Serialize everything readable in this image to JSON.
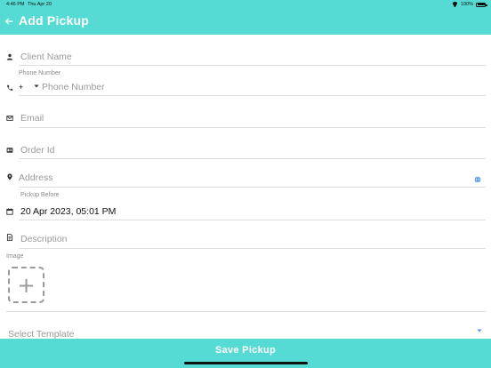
{
  "status_bar": {
    "time": "4:46 PM",
    "date": "Thu Apr 20",
    "battery": "100%"
  },
  "header": {
    "title": "Add Pickup",
    "back_icon": "back-arrow-icon"
  },
  "form": {
    "client_name": {
      "placeholder": "Client Name",
      "icon": "person-icon"
    },
    "phone": {
      "label": "Phone Number",
      "country_code": "+",
      "placeholder": "Phone Number",
      "icon": "phone-icon"
    },
    "email": {
      "placeholder": "Email",
      "icon": "envelope-icon"
    },
    "order_id": {
      "placeholder": "Order Id",
      "icon": "id-card-icon"
    },
    "address": {
      "placeholder": "Address",
      "icon": "location-pin-icon",
      "action_icon": "globe-icon"
    },
    "pickup_before": {
      "label": "Pickup Before",
      "value": "20 Apr 2023, 05:01 PM",
      "icon": "calendar-icon"
    },
    "description": {
      "placeholder": "Description",
      "icon": "document-icon"
    },
    "image": {
      "label": "Image",
      "add_icon": "+"
    },
    "template": {
      "placeholder": "Select Template",
      "icon": "dropdown-arrow-icon"
    }
  },
  "footer": {
    "save_label": "Save Pickup"
  },
  "colors": {
    "accent": "#55dbd3",
    "globe": "#4a90e2"
  }
}
